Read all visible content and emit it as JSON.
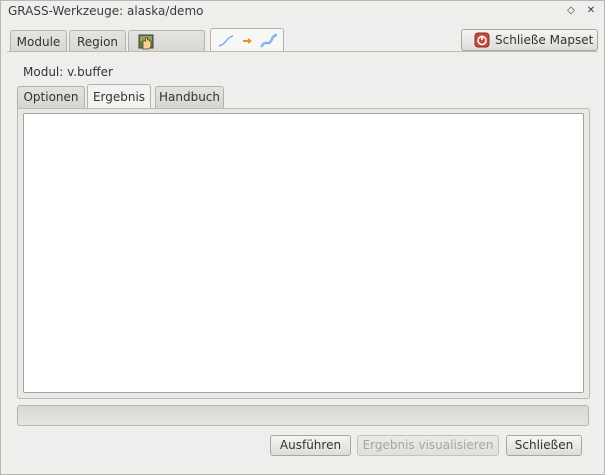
{
  "window": {
    "title": "GRASS-Werkzeuge: alaska/demo",
    "buttons": {
      "restore_symbol": "◇",
      "close_symbol": "✕"
    }
  },
  "top_tabs": [
    {
      "label": "Module"
    },
    {
      "label": "Region"
    },
    {
      "label": "",
      "icon": "hand-map-icon"
    },
    {
      "label": "",
      "icon": "line-to-curve-icon",
      "active": true
    }
  ],
  "close_mapset_button": {
    "label": "Schließe Mapset",
    "icon": "power-icon"
  },
  "module": {
    "label": "Modul: v.buffer"
  },
  "sub_tabs": [
    {
      "label": "Optionen"
    },
    {
      "label": "Ergebnis",
      "active": true
    },
    {
      "label": "Handbuch"
    }
  ],
  "output": {
    "text": ""
  },
  "progress": {
    "value": 0
  },
  "actions": {
    "run": "Ausführen",
    "visualize": "Ergebnis visualisieren",
    "close": "Schließen"
  },
  "colors": {
    "accent_orange": "#e8922c",
    "power_red": "#c8483a",
    "curve_blue": "#3a8fd9"
  }
}
